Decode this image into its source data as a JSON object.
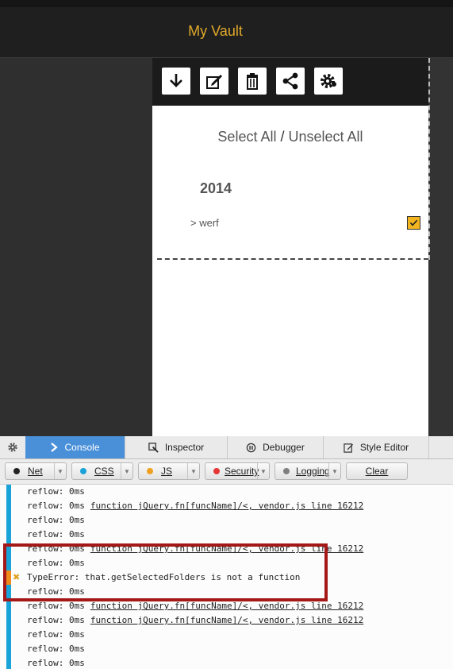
{
  "app": {
    "title": "My Vault"
  },
  "toolbar": {
    "icons": [
      "download-icon",
      "edit-icon",
      "trash-icon",
      "share-icon",
      "settings-icon"
    ]
  },
  "panel": {
    "select_all": "Select All",
    "separator": "/",
    "unselect_all": "Unselect All",
    "year": "2014",
    "folder": "> werf",
    "folder_checked": true
  },
  "devtools": {
    "tabs": [
      {
        "label": "Console",
        "icon": "console-chevron-icon",
        "active": true
      },
      {
        "label": "Inspector",
        "icon": "inspector-icon",
        "active": false
      },
      {
        "label": "Debugger",
        "icon": "debugger-icon",
        "active": false
      },
      {
        "label": "Style Editor",
        "icon": "style-editor-icon",
        "active": false
      }
    ],
    "filters": [
      {
        "label": "Net",
        "dot_color": "#222222"
      },
      {
        "label": "CSS",
        "dot_color": "#1aa3d9"
      },
      {
        "label": "JS",
        "dot_color": "#f0a020"
      },
      {
        "label": "Security",
        "dot_color": "#e53535"
      },
      {
        "label": "Logging",
        "dot_color": "#808080"
      }
    ],
    "clear_label": "Clear",
    "log": [
      {
        "text": "reflow: 0ms",
        "link": "",
        "type": "log"
      },
      {
        "text": "reflow: 0ms",
        "link": "function jQuery.fn[funcName]/<, vendor.js line 16212",
        "type": "log"
      },
      {
        "text": "reflow: 0ms",
        "link": "",
        "type": "log"
      },
      {
        "text": "reflow: 0ms",
        "link": "",
        "type": "log"
      },
      {
        "text": "reflow: 0ms",
        "link": "function jQuery.fn[funcName]/<, vendor.js line 16212",
        "type": "log"
      },
      {
        "text": "reflow: 0ms",
        "link": "",
        "type": "log"
      },
      {
        "text": "TypeError: that.getSelectedFolders is not a function",
        "link": "",
        "type": "error"
      },
      {
        "text": "reflow: 0ms",
        "link": "",
        "type": "log"
      },
      {
        "text": "reflow: 0ms",
        "link": "function jQuery.fn[funcName]/<, vendor.js line 16212",
        "type": "log"
      },
      {
        "text": "reflow: 0ms",
        "link": "function jQuery.fn[funcName]/<, vendor.js line 16212",
        "type": "log"
      },
      {
        "text": "reflow: 0ms",
        "link": "",
        "type": "log"
      },
      {
        "text": "reflow: 0ms",
        "link": "",
        "type": "log"
      },
      {
        "text": "reflow: 0ms",
        "link": "",
        "type": "log"
      }
    ]
  },
  "colors": {
    "accent": "#e0a92a",
    "console_active": "#4a90d9",
    "error_highlight": "#a41818",
    "checkbox": "#f2b51f"
  }
}
